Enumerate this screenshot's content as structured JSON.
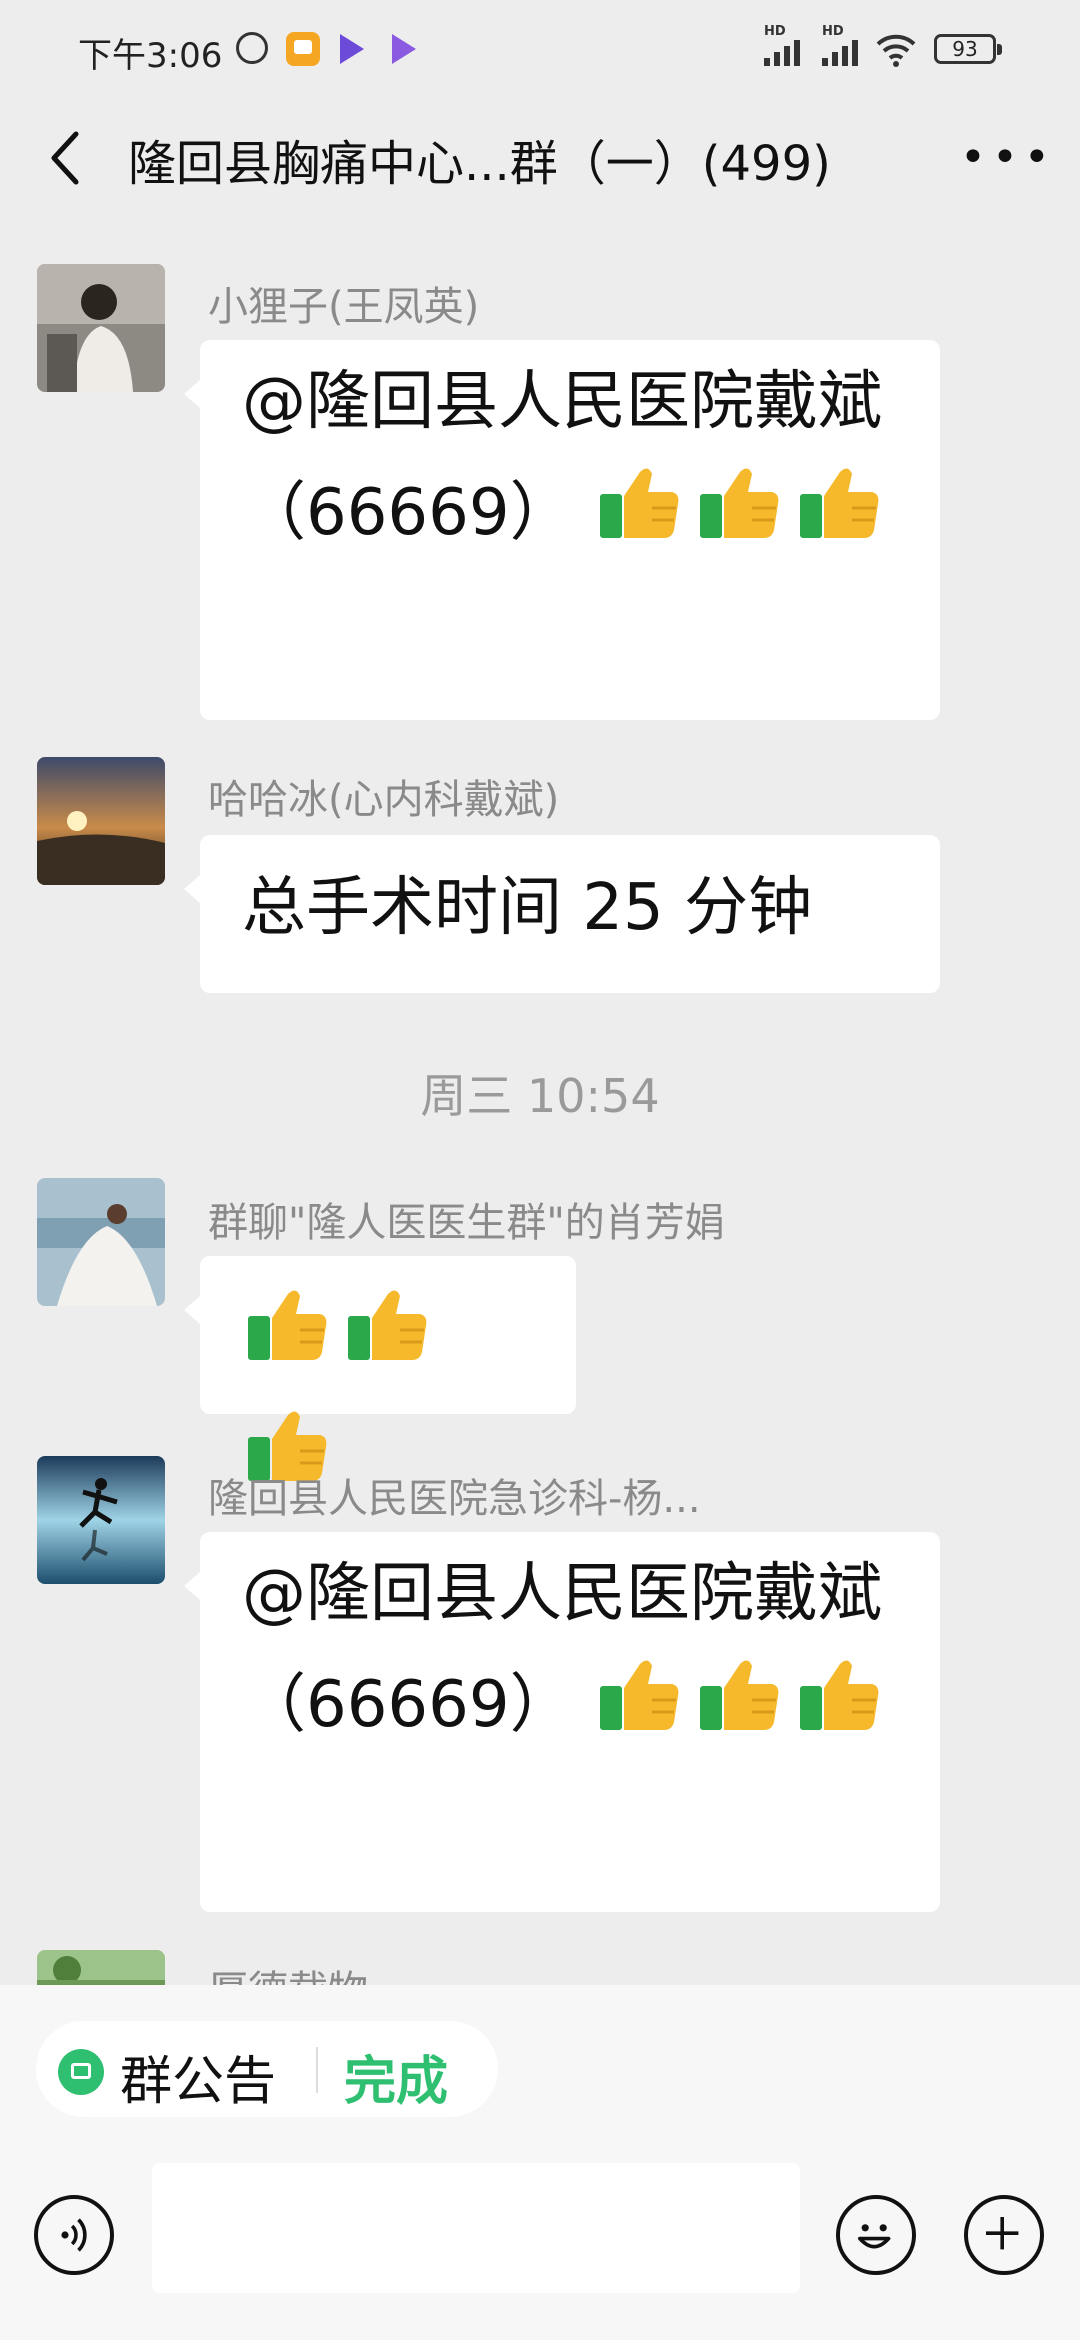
{
  "status_bar": {
    "time": "下午3:06",
    "battery": "93",
    "hd1": "HD",
    "hd2": "HD"
  },
  "header": {
    "title": "隆回县胸痛中心...群（一）(499)"
  },
  "messages": [
    {
      "sender": "小狸子(王凤英)",
      "text": "@隆回县人民医院戴斌（66669）",
      "thumbs": 3
    },
    {
      "sender": "哈哈冰(心内科戴斌)",
      "text": "总手术时间 25 分钟"
    },
    {
      "timestamp": "周三 10:54"
    },
    {
      "sender": "群聊\"隆人医医生群\"的肖芳娟",
      "thumbs": 3
    },
    {
      "sender": "隆回县人民医院急诊科-杨...",
      "text": "@隆回县人民医院戴斌（66669）",
      "thumbs": 3
    },
    {
      "sender": "厚德载物"
    }
  ],
  "bottom": {
    "notice_label": "群公告",
    "notice_action": "完成"
  },
  "colors": {
    "accent": "#2fbf71",
    "background": "#ededed"
  }
}
